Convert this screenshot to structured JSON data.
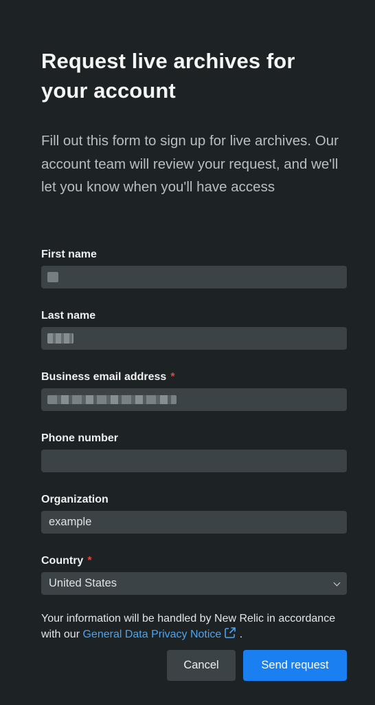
{
  "form": {
    "title": "Request live archives for your account",
    "description": "Fill out this form to sign up for live archives. Our account team will review your request, and we'll let you know when you'll have access",
    "fields": {
      "first_name": {
        "label": "First name",
        "value": ""
      },
      "last_name": {
        "label": "Last name",
        "value": ""
      },
      "email": {
        "label": "Business email address",
        "required_mark": "*",
        "value": ""
      },
      "phone": {
        "label": "Phone number",
        "value": ""
      },
      "organization": {
        "label": "Organization",
        "value": "example"
      },
      "country": {
        "label": "Country",
        "required_mark": "*",
        "value": "United States"
      }
    },
    "notice": {
      "prefix": "Your information will be handled by New Relic in accordance with our ",
      "link_text": "General Data Privacy Notice",
      "suffix": " ."
    },
    "buttons": {
      "cancel": "Cancel",
      "send": "Send request"
    }
  },
  "icons": {
    "external_link": "external-link-icon",
    "chevron": "chevron-down-icon"
  },
  "colors": {
    "background": "#1d2224",
    "input_bg": "#3b4347",
    "primary": "#1a7ff0",
    "link": "#4ea4ee",
    "required": "#e0473d"
  }
}
